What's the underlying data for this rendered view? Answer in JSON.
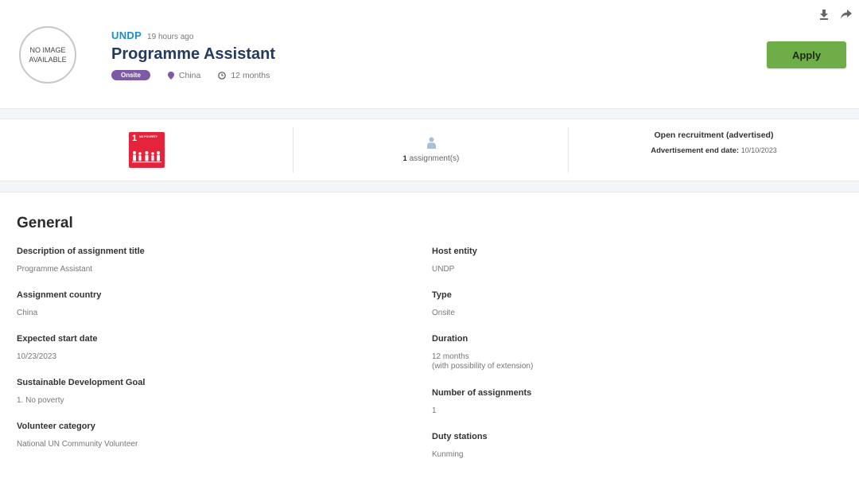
{
  "header": {
    "logo_text_line1": "NO IMAGE",
    "logo_text_line2": "AVAILABLE",
    "org": "UNDP",
    "posted": "19 hours ago",
    "title": "Programme Assistant",
    "badge": "Onsite",
    "location": "China",
    "duration": "12 months",
    "apply_label": "Apply"
  },
  "info": {
    "sdg_number": "1",
    "sdg_tile_text": "NO POVERTY",
    "assignments_count": "1",
    "assignments_label": "assignment(s)",
    "recruitment_title": "Open recruitment (advertised)",
    "ad_end_label": "Advertisement end date:",
    "ad_end_date": "10/10/2023"
  },
  "general": {
    "heading": "General",
    "left": [
      {
        "label": "Description of assignment title",
        "value": "Programme Assistant"
      },
      {
        "label": "Assignment country",
        "value": "China"
      },
      {
        "label": "Expected start date",
        "value": "10/23/2023"
      },
      {
        "label": "Sustainable Development Goal",
        "value": "1. No poverty"
      },
      {
        "label": "Volunteer category",
        "value": "National UN Community Volunteer"
      }
    ],
    "right": [
      {
        "label": "Host entity",
        "value": "UNDP"
      },
      {
        "label": "Type",
        "value": "Onsite"
      },
      {
        "label": "Duration",
        "value": "12 months",
        "sub": "(with possibility of extension)"
      },
      {
        "label": "Number of assignments",
        "value": "1"
      },
      {
        "label": "Duty stations",
        "value": "Kunming"
      }
    ]
  },
  "colors": {
    "accent_blue": "#1b8fd1",
    "title_navy": "#243a5e",
    "badge_purple": "#7d5aa6",
    "apply_green": "#6fad49",
    "sdg_red": "#e5243b"
  },
  "icons": [
    "download-icon",
    "share-icon",
    "location-pin-icon",
    "clock-icon",
    "person-icon",
    "sdg-1-no-poverty-icon"
  ]
}
